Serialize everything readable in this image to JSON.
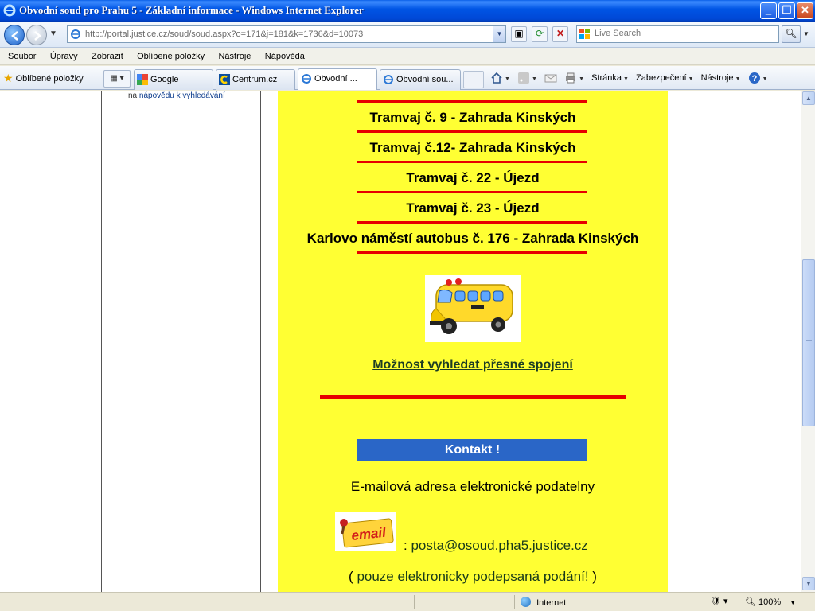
{
  "window": {
    "title": "Obvodní soud pro Prahu 5 - Základní informace - Windows Internet Explorer",
    "minimize_icon": "minimize-icon",
    "maximize_icon": "restore-icon",
    "close_icon": "close-icon"
  },
  "address_bar": {
    "url": "http://portal.justice.cz/soud/soud.aspx?o=171&j=181&k=1736&d=10073"
  },
  "search": {
    "placeholder": "Live Search"
  },
  "menu": [
    "Soubor",
    "Úpravy",
    "Zobrazit",
    "Oblíbené položky",
    "Nástroje",
    "Nápověda"
  ],
  "favorites": {
    "label": "Oblíbené položky"
  },
  "tabs": [
    {
      "label": "Google",
      "icon": "google-icon"
    },
    {
      "label": "Centrum.cz",
      "icon": "centrum-icon"
    },
    {
      "label": "Obvodní ...",
      "icon": "ie-page-icon",
      "active": true
    },
    {
      "label": "Obvodní sou...",
      "icon": "ie-page-icon"
    }
  ],
  "command_bar": {
    "page": "Stránka",
    "security": "Zabezpečení",
    "tools": "Nástroje"
  },
  "sidebar": {
    "hint_prefix": "na",
    "hint_link": "nápovědu k vyhledávání"
  },
  "content": {
    "routes": [
      "Tramvaj č. 9 - Zahrada Kinských",
      "Tramvaj č.12- Zahrada Kinských",
      "Tramvaj č. 22 - Újezd",
      "Tramvaj č. 23 - Újezd",
      "Karlovo náměstí autobus č. 176 - Zahrada Kinských"
    ],
    "connection_link": "Možnost vyhledat  přesné spojení",
    "contact_button": "Kontakt !",
    "email_heading": "E-mailová adresa elektronické podatelny",
    "email_image_text": "email",
    "email_prefix": ":",
    "email_address": "posta@osoud.pha5.justice.cz",
    "note_open": "(",
    "note_link": "pouze elektronicky podepsaná podání!",
    "note_close": ")"
  },
  "status_bar": {
    "zone": "Internet",
    "zoom": "100%"
  },
  "colors": {
    "page_background": "#ffff33",
    "separator": "#e60000",
    "contact_button": "#2a66c7",
    "link": "#183a1a"
  }
}
